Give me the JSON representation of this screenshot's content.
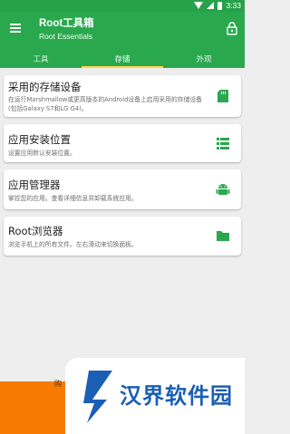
{
  "status_bar": {
    "time": "3:33"
  },
  "app_bar": {
    "title": "Root工具箱",
    "subtitle": "Root Essentials"
  },
  "tabs": [
    {
      "label": "工具"
    },
    {
      "label": "存储"
    },
    {
      "label": "外观"
    }
  ],
  "cards": [
    {
      "title": "采用的存储设备",
      "desc": "在运行Marshmallow或更高版本的Android设备上启用采用的存储设备 (包括Galaxy S7和LG G4)。",
      "icon": "sd-card-icon"
    },
    {
      "title": "应用安装位置",
      "desc": "设置应用默认安装位置。",
      "icon": "list-icon"
    },
    {
      "title": "应用管理器",
      "desc": "掌控您的应用。查看详细信息并卸载系统应用。",
      "icon": "android-icon"
    },
    {
      "title": "Root浏览器",
      "desc": "浏览手机上的所有文件。左右滑动来切换面板。",
      "icon": "folder-icon"
    }
  ],
  "bottom": {
    "buy_text": "购"
  },
  "watermark": {
    "text": "汉界软件园"
  },
  "colors": {
    "primary": "#2aa84e",
    "status": "#27a14a",
    "accent": "#ffd740",
    "bottom": "#f57c00"
  }
}
